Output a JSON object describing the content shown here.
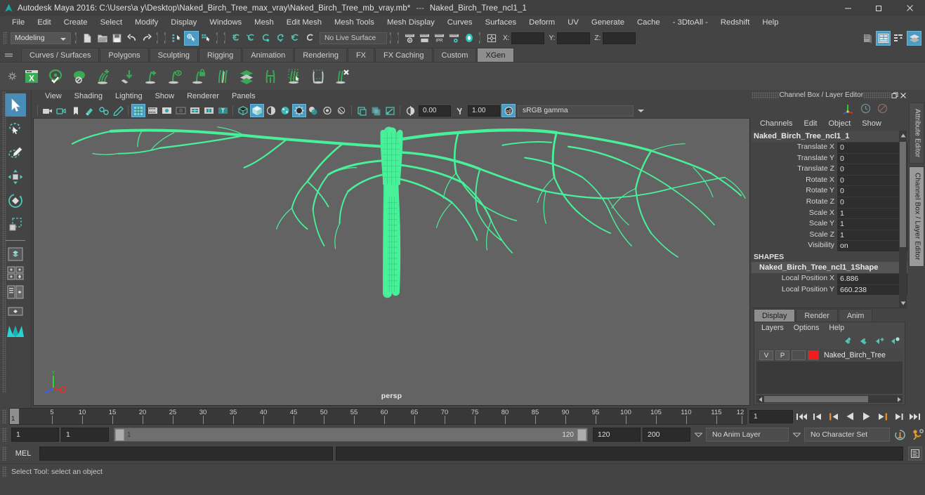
{
  "window": {
    "title": "Autodesk Maya 2016: C:\\Users\\a y\\Desktop\\Naked_Birch_Tree_max_vray\\Naked_Birch_Tree_mb_vray.mb*",
    "separator": "---",
    "subtitle": "Naked_Birch_Tree_ncl1_1",
    "minimize": "minimize-button",
    "maximize": "maximize-button",
    "close": "close-button"
  },
  "menubar": {
    "items": [
      "File",
      "Edit",
      "Create",
      "Select",
      "Modify",
      "Display",
      "Windows",
      "Mesh",
      "Edit Mesh",
      "Mesh Tools",
      "Mesh Display",
      "Curves",
      "Surfaces",
      "Deform",
      "UV",
      "Generate",
      "Cache",
      "- 3DtoAll -",
      "Redshift",
      "Help"
    ]
  },
  "statusline": {
    "menuset": "Modeling",
    "live_surface": "No Live Surface",
    "coord_labels": [
      "X:",
      "Y:",
      "Z:"
    ],
    "coord_values": [
      "",
      "",
      ""
    ],
    "icons_file": [
      "new-scene-icon",
      "open-scene-icon",
      "save-scene-icon",
      "undo-icon",
      "redo-icon"
    ],
    "icons_selmode": [
      "select-by-hierarchy-icon",
      "select-by-object-type-icon",
      "select-by-component-type-icon"
    ],
    "icons_snap": [
      "snap-to-grid-icon",
      "snap-to-curve-icon",
      "snap-to-point-icon",
      "snap-to-projected-center-icon",
      "snap-to-view-plane-icon",
      "make-live-icon"
    ],
    "icons_render": [
      "render-current-frame-icon",
      "render-sequence-icon",
      "ipr-render-icon",
      "render-settings-icon",
      "hypershade-icon"
    ],
    "icons_right": [
      "toggle-attribute-editor-icon",
      "toggle-tool-settings-icon",
      "toggle-channel-box-icon",
      "toggle-sidebar-icon"
    ]
  },
  "shelf": {
    "tabs": [
      "Curves / Surfaces",
      "Polygons",
      "Sculpting",
      "Rigging",
      "Animation",
      "Rendering",
      "FX",
      "FX Caching",
      "Custom",
      "XGen"
    ],
    "active_tab": "XGen",
    "icons": [
      "xgen-editor-icon",
      "preview-refresh-icon",
      "disable-preview-icon",
      "add-guides-icon",
      "place-guide-icon",
      "add-grooming-description-icon",
      "groom-visibility-icon",
      "lock-groom-icon",
      "comb-brush-icon",
      "layers-icon",
      "clump-modifier-icon",
      "select-guides-icon",
      "region-mask-icon",
      "delete-guides-icon"
    ]
  },
  "toolbox": {
    "tools": [
      "select-tool",
      "lasso-select-tool",
      "paint-select-tool",
      "move-tool",
      "rotate-tool",
      "scale-tool"
    ],
    "selected": "select-tool",
    "layouts": [
      "single-perspective-view-layout",
      "four-view-layout",
      "persp-outliner-layout",
      "persp-graph-editor-layout",
      "hypershade-persp-layout",
      "maya-logo-icon"
    ]
  },
  "viewport": {
    "menus": [
      "View",
      "Shading",
      "Lighting",
      "Show",
      "Renderer",
      "Panels"
    ],
    "camera_label": "persp",
    "background_color": "#636363",
    "mesh_color": "#49f09a",
    "toolbar": {
      "gamma_label": "sRGB gamma",
      "exposure_value": "0.00",
      "gamma_value": "1.00",
      "icons": [
        "select-camera-icon",
        "lock-camera-icon",
        "camera-bookmark-icon",
        "image-plane-icon",
        "two-d-pan-zoom-icon",
        "grease-pencil-icon",
        "grid-toggle-icon",
        "film-gate-icon",
        "resolution-gate-icon",
        "gate-mask-icon",
        "film-origin-icon",
        "field-chart-icon",
        "safe-title-icon",
        "wireframe-icon",
        "smooth-shade-all-icon",
        "shaded-wireframe-icon",
        "textured-icon",
        "use-all-lights-icon",
        "shadows-icon",
        "screen-space-ao-icon",
        "motion-blur-icon",
        "multisample-icon",
        "depth-of-field-icon",
        "isolate-select-icon",
        "xray-icon",
        "xray-joints-icon",
        "xray-active-components-icon",
        "exposure-icon",
        "gamma-icon",
        "view-transform-icon"
      ]
    },
    "axis_labels": [
      "x",
      "y",
      "z"
    ]
  },
  "channelbox": {
    "panel_title": "Channel Box / Layer Editor",
    "menus": [
      "Channels",
      "Edit",
      "Object",
      "Show"
    ],
    "tool_icons": [
      "manipulator-icon",
      "clock-icon",
      "no-entry-icon"
    ],
    "node_name": "Naked_Birch_Tree_ncl1_1",
    "attributes": [
      {
        "label": "Translate X",
        "value": "0"
      },
      {
        "label": "Translate Y",
        "value": "0"
      },
      {
        "label": "Translate Z",
        "value": "0"
      },
      {
        "label": "Rotate X",
        "value": "0"
      },
      {
        "label": "Rotate Y",
        "value": "0"
      },
      {
        "label": "Rotate Z",
        "value": "0"
      },
      {
        "label": "Scale X",
        "value": "1"
      },
      {
        "label": "Scale Y",
        "value": "1"
      },
      {
        "label": "Scale Z",
        "value": "1"
      },
      {
        "label": "Visibility",
        "value": "on"
      }
    ],
    "shapes_label": "SHAPES",
    "shape_name": "Naked_Birch_Tree_ncl1_1Shape",
    "shape_attributes": [
      {
        "label": "Local Position X",
        "value": "6.886"
      },
      {
        "label": "Local Position Y",
        "value": "660.238"
      }
    ]
  },
  "layer_editor": {
    "tabs": [
      "Display",
      "Render",
      "Anim"
    ],
    "active_tab": "Display",
    "menus": [
      "Layers",
      "Options",
      "Help"
    ],
    "buttons": [
      "move-layer-up-icon",
      "move-layer-down-icon",
      "new-layer-icon",
      "new-layer-from-selected-icon"
    ],
    "layers": [
      {
        "visibility": "V",
        "playback": "P",
        "type": "",
        "color": "#ef1e1e",
        "name": "Naked_Birch_Tree"
      }
    ]
  },
  "side_tabs": {
    "items": [
      "Attribute Editor",
      "Channel Box / Layer Editor"
    ],
    "active": "Channel Box / Layer Editor"
  },
  "timeslider": {
    "tick_labels": [
      "5",
      "10",
      "15",
      "20",
      "25",
      "30",
      "35",
      "40",
      "45",
      "50",
      "55",
      "60",
      "65",
      "70",
      "75",
      "80",
      "85",
      "90",
      "95",
      "100",
      "105",
      "110",
      "115",
      "12"
    ],
    "current_frame_marker": "1",
    "current_frame_field": "1",
    "playback_buttons": [
      "go-to-start-icon",
      "step-back-keyframe-icon",
      "step-back-frame-icon",
      "play-backwards-icon",
      "play-forwards-icon",
      "step-forward-frame-icon",
      "step-forward-keyframe-icon",
      "go-to-end-icon"
    ]
  },
  "rangeslider": {
    "anim_start": "1",
    "range_start": "1",
    "slider_left_label": "1",
    "slider_right_label": "120",
    "range_end": "120",
    "anim_end": "200",
    "anim_layer": "No Anim Layer",
    "character_set": "No Character Set",
    "icons": [
      "auto-keyframe-icon",
      "animation-preferences-icon"
    ]
  },
  "commandline": {
    "mode_label": "MEL",
    "input_value": "",
    "output_value": "",
    "script_editor_icon": "script-editor-icon"
  },
  "helpline": {
    "text": "Select Tool: select an object"
  }
}
